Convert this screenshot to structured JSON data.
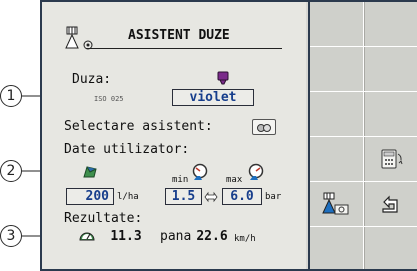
{
  "callouts": [
    "1",
    "2",
    "3"
  ],
  "screen": {
    "title": "ASISTENT DUZE",
    "nozzle_label": "Duza:",
    "nozzle_standard": "ISO 025",
    "nozzle_color_value": "violet",
    "assistant_label": "Selectare asistent:",
    "user_data_label": "Date utilizator:",
    "min_label": "min",
    "max_label": "max",
    "rate_value": "200",
    "rate_unit": "l/ha",
    "pressure_min": "1.5",
    "pressure_max": "6.0",
    "pressure_unit": "bar",
    "results_label": "Rezultate:",
    "speed_min": "11.3",
    "until_label": "pana",
    "speed_max": "22.6",
    "speed_unit": "km/h"
  },
  "softkeys": {
    "calculator_icon": "calculator-rotate-icon",
    "nozzle_settings_icon": "nozzle-settings-icon",
    "back_icon": "return-arrow-icon"
  },
  "colors": {
    "nozzle_violet": "#7a2a8a",
    "value_blue": "#173e8c",
    "frame": "#2b3a4e"
  }
}
